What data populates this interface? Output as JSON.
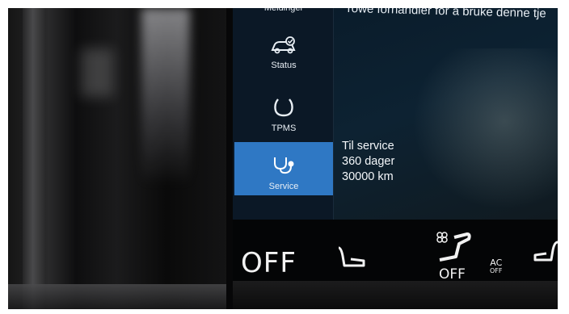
{
  "screen": {
    "header_text": "rowe forhandler for å bruke denne tje",
    "sidebar": [
      {
        "label": "Meldinger",
        "icon": "envelope-icon"
      },
      {
        "label": "Status",
        "icon": "car-check-icon"
      },
      {
        "label": "TPMS",
        "icon": "tire-pressure-icon"
      },
      {
        "label": "Service",
        "icon": "stethoscope-icon",
        "selected": true
      }
    ],
    "service_info": {
      "title": "Til service",
      "days": "360 dager",
      "distance": "30000 km"
    }
  },
  "climate_bar": {
    "left_temp": "OFF",
    "seat_heat_status": "OFF",
    "ac_label_top": "AC",
    "ac_label_bottom": "OFF"
  },
  "colors": {
    "selected_item": "#2f78c4",
    "screen_bg": "#061522"
  }
}
